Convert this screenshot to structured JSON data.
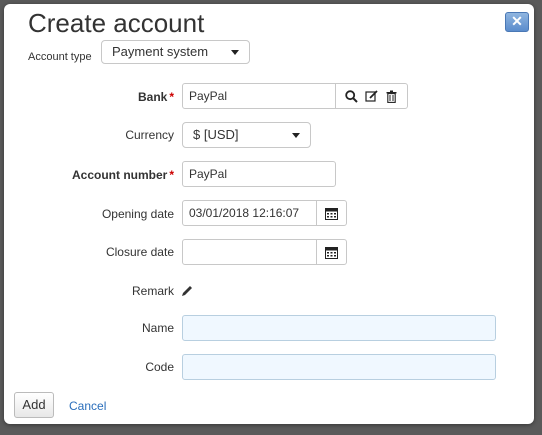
{
  "dialog": {
    "title": "Create account",
    "close_symbol": "✕"
  },
  "account_type": {
    "label": "Account type",
    "value": "Payment system"
  },
  "fields": {
    "bank": {
      "label": "Bank",
      "required_mark": "*",
      "value": "PayPal"
    },
    "currency": {
      "label": "Currency",
      "value": "$ [USD]"
    },
    "account_number": {
      "label": "Account number",
      "required_mark": "*",
      "value": "PayPal"
    },
    "opening_date": {
      "label": "Opening date",
      "value": "03/01/2018 12:16:07"
    },
    "closure_date": {
      "label": "Closure date",
      "value": ""
    },
    "remark": {
      "label": "Remark"
    },
    "name": {
      "label": "Name",
      "value": ""
    },
    "code": {
      "label": "Code",
      "value": ""
    }
  },
  "actions": {
    "add_label": "Add",
    "cancel_label": "Cancel"
  },
  "icons": [
    "close-icon",
    "chevron-down-icon",
    "search-icon",
    "edit-icon",
    "trash-icon",
    "calendar-icon",
    "pencil-icon"
  ],
  "colors": {
    "required": "#cc0000",
    "link": "#2a6ebb",
    "input_highlight": "#f0f8ff",
    "close_button": "#5b8ccc"
  }
}
